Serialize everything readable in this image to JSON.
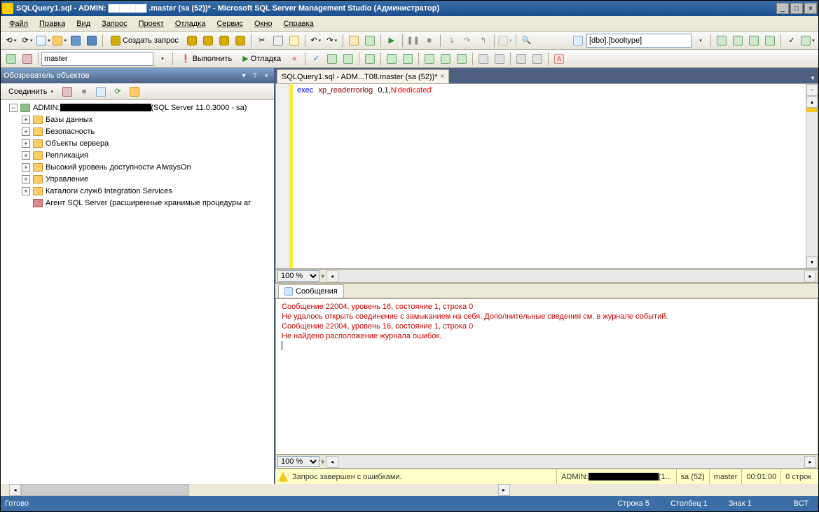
{
  "titlebar": {
    "text": "SQLQuery1.sql - ADMIN: ███████ .master (sa (52))* - Microsoft SQL Server Management Studio (Администратор)"
  },
  "menu": {
    "file": "Файл",
    "edit": "Правка",
    "view": "Вид",
    "query": "Запрос",
    "project": "Проект",
    "debug": "Отладка",
    "service": "Сервис",
    "window": "Окно",
    "help": "Справка"
  },
  "toolbar1": {
    "new_query": "Создать запрос",
    "schema_combo": "[dbo].[booltype]"
  },
  "toolbar2": {
    "db_combo": "master",
    "execute": "Выполнить",
    "debug": "Отладка"
  },
  "objexplorer": {
    "title": "Обозреватель объектов",
    "connect": "Соединить",
    "server": "ADMIN:",
    "server_suffix": "(SQL Server 11.0.3000 - sa)",
    "nodes": {
      "databases": "Базы данных",
      "security": "Безопасность",
      "server_objects": "Объекты сервера",
      "replication": "Репликация",
      "alwayson": "Высокий уровень доступности AlwaysOn",
      "management": "Управление",
      "integration": "Каталоги служб Integration Services",
      "agent": "Агент SQL Server (расширенные хранимые процедуры аг"
    }
  },
  "editor": {
    "tab": "SQLQuery1.sql - ADM...T08.master (sa (52))*",
    "zoom": "100 %",
    "code": {
      "kw_exec": "exec",
      "sp_name": "xp_readerrorlog",
      "arg_nums": "0,1,",
      "arg_prefix": "N",
      "arg_str": "'dedicated'"
    }
  },
  "messages": {
    "tab": "Сообщения",
    "line1": "Сообщение 22004, уровень 16, состояние 1, строка 0",
    "line2": "Не удалось открыть соединение с замыканием на себя. Дополнительные сведения см. в журнале событий.",
    "line3": "Сообщение 22004, уровень 16, состояние 1, строка 0",
    "line4": "Не найдено расположение журнала ошибок.",
    "zoom": "100 %"
  },
  "statusbar_yellow": {
    "text": "Запрос завершен с ошибками.",
    "server": "ADMIN:",
    "server_suffix": "(1...",
    "login": "sa (52)",
    "db": "master",
    "time": "00:01:00",
    "rows": "0 строк"
  },
  "statusbar_app": {
    "ready": "Готово",
    "line": "Строка 5",
    "col": "Столбец 1",
    "char": "Знак 1",
    "ins": "ВСТ"
  }
}
